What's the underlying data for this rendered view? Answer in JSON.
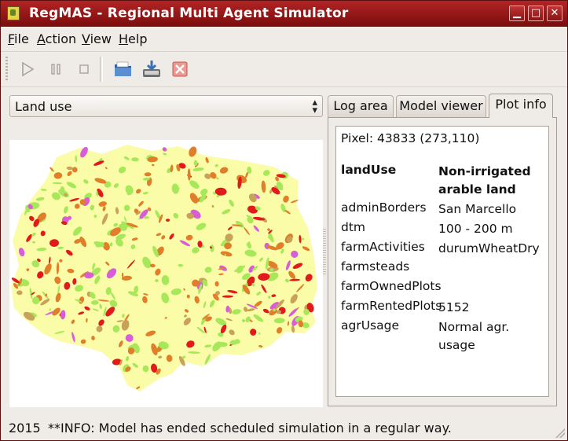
{
  "window": {
    "title": "RegMAS - Regional Multi Agent Simulator",
    "minimize": "▁",
    "maximize": "□",
    "close": "✕"
  },
  "menu": [
    {
      "accel": "F",
      "rest": "ile"
    },
    {
      "accel": "A",
      "rest": "ction"
    },
    {
      "accel": "V",
      "rest": "iew"
    },
    {
      "accel": "H",
      "rest": "elp"
    }
  ],
  "toolbar": {
    "icons": [
      "play-icon",
      "pause-icon",
      "stop-icon",
      "open-folder-icon",
      "save-icon",
      "cancel-icon"
    ],
    "disabled_color": "#a8a29b",
    "folder_color": "#3a6fb5",
    "cancel_color": "#d9564c"
  },
  "layer_select": {
    "value": "Land use"
  },
  "tabs": [
    {
      "label": "Log area",
      "active": false
    },
    {
      "label": "Model viewer",
      "active": false
    },
    {
      "label": "Plot info",
      "active": true
    }
  ],
  "plot_info": {
    "pixel": "Pixel: 43833 (273,110)",
    "rows": [
      {
        "key": "landUse",
        "value": "Non-irrigated arable land",
        "bold": true
      },
      {
        "key": "adminBorders",
        "value": "San Marcello"
      },
      {
        "key": "dtm",
        "value": "100 - 200 m"
      },
      {
        "key": "farmActivities",
        "value": "durumWheatDry"
      },
      {
        "key": "farmsteads",
        "value": ""
      },
      {
        "key": "farmOwnedPlots",
        "value": ""
      },
      {
        "key": "farmRentedPlots",
        "value": "5152"
      },
      {
        "key": "agrUsage",
        "value": "Normal agr. usage"
      }
    ]
  },
  "map_colors": {
    "base": "#fbfca8",
    "green": "#a6e85a",
    "orange": "#e07e2a",
    "red": "#e31a1c",
    "magenta": "#d85ed8",
    "brown": "#c9a25a"
  },
  "status": {
    "year": "2015",
    "message": "**INFO: Model has ended scheduled simulation in a regular way."
  }
}
